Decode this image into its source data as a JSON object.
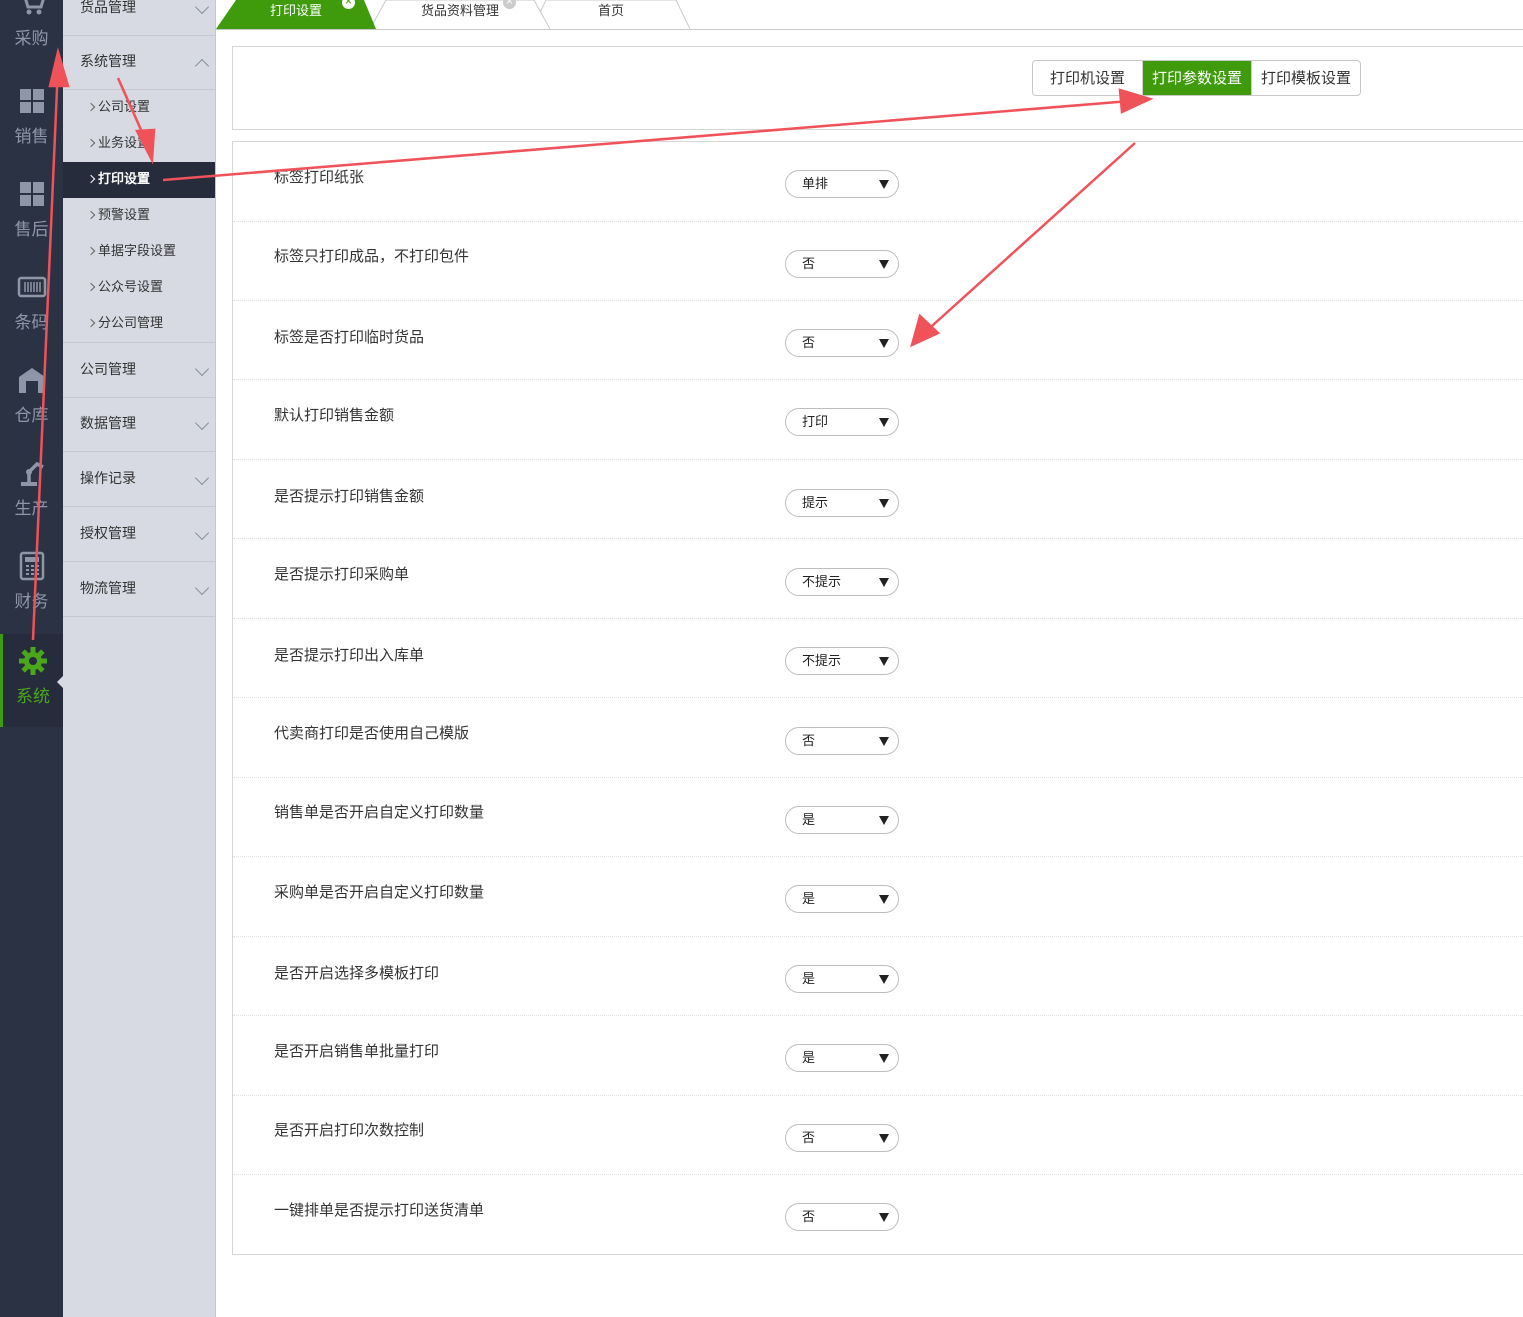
{
  "rail": {
    "items": [
      {
        "label": "采购",
        "icon": "cart-icon"
      },
      {
        "label": "销售",
        "icon": "boxes-icon"
      },
      {
        "label": "售后",
        "icon": "boxes-icon"
      },
      {
        "label": "条码",
        "icon": "barcode-icon"
      },
      {
        "label": "仓库",
        "icon": "warehouse-icon"
      },
      {
        "label": "生产",
        "icon": "robot-arm-icon"
      },
      {
        "label": "财务",
        "icon": "calculator-icon"
      },
      {
        "label": "系统",
        "icon": "gear-icon"
      }
    ],
    "active_color": "#4aa71b"
  },
  "submenu": {
    "groups_before": [
      {
        "label": "货品管理"
      }
    ],
    "open_group": {
      "label": "系统管理"
    },
    "subitems": [
      {
        "label": "公司设置"
      },
      {
        "label": "业务设置"
      },
      {
        "label": "打印设置"
      },
      {
        "label": "预警设置"
      },
      {
        "label": "单据字段设置"
      },
      {
        "label": "公众号设置"
      },
      {
        "label": "分公司管理"
      }
    ],
    "groups_after": [
      {
        "label": "公司管理"
      },
      {
        "label": "数据管理"
      },
      {
        "label": "操作记录"
      },
      {
        "label": "授权管理"
      },
      {
        "label": "物流管理"
      }
    ]
  },
  "tabs": [
    {
      "label": "打印设置",
      "active": true
    },
    {
      "label": "货品资料管理"
    },
    {
      "label": "首页"
    }
  ],
  "segment": {
    "buttons": [
      {
        "label": "打印机设置"
      },
      {
        "label": "打印参数设置",
        "active": true
      },
      {
        "label": "打印模板设置"
      }
    ],
    "accent": "#3f9b0c"
  },
  "settings": [
    {
      "label": "标签打印纸张",
      "value": "单排"
    },
    {
      "label": "标签只打印成品，不打印包件",
      "value": "否"
    },
    {
      "label": "标签是否打印临时货品",
      "value": "否"
    },
    {
      "label": "默认打印销售金额",
      "value": "打印"
    },
    {
      "label": "是否提示打印销售金额",
      "value": "提示"
    },
    {
      "label": "是否提示打印采购单",
      "value": "不提示"
    },
    {
      "label": "是否提示打印出入库单",
      "value": "不提示"
    },
    {
      "label": "代卖商打印是否使用自己模版",
      "value": "否"
    },
    {
      "label": "销售单是否开启自定义打印数量",
      "value": "是"
    },
    {
      "label": "采购单是否开启自定义打印数量",
      "value": "是"
    },
    {
      "label": "是否开启选择多模板打印",
      "value": "是"
    },
    {
      "label": "是否开启销售单批量打印",
      "value": "是"
    },
    {
      "label": "是否开启打印次数控制",
      "value": "否"
    },
    {
      "label": "一键排单是否提示打印送货清单",
      "value": "否"
    }
  ],
  "annotation_color": "#f0525a"
}
